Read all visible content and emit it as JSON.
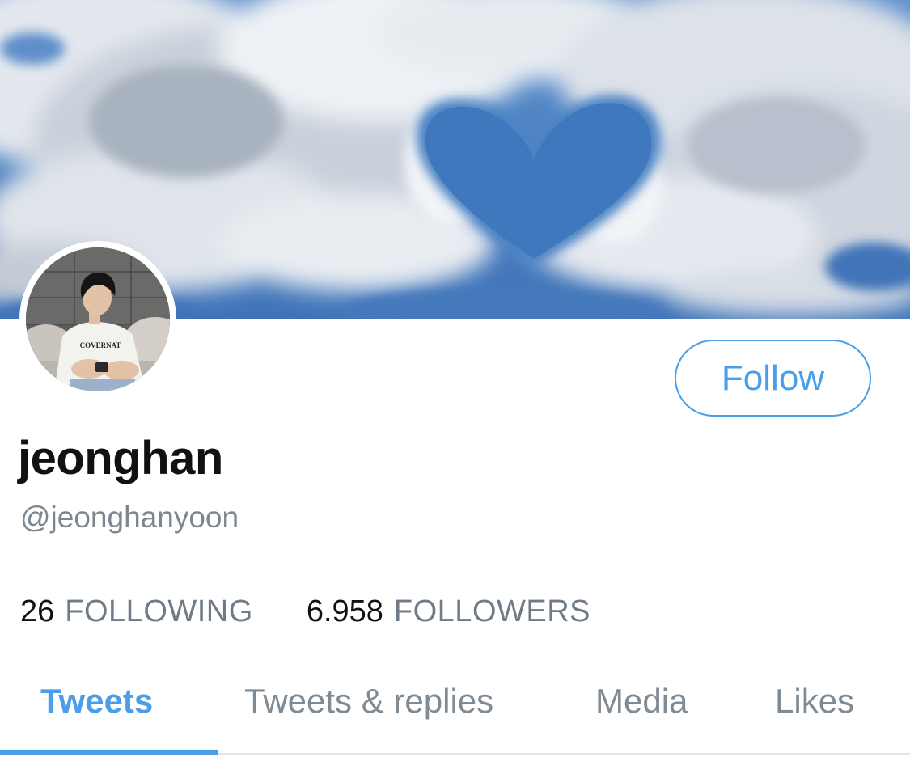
{
  "profile": {
    "display_name": "jeonghan",
    "handle": "@jeonghanyoon",
    "follow_label": "Follow"
  },
  "stats": {
    "following_count": "26",
    "following_label": "FOLLOWING",
    "followers_count": "6.958",
    "followers_label": "FOLLOWERS"
  },
  "tabs": [
    {
      "label": "Tweets",
      "active": true
    },
    {
      "label": "Tweets & replies",
      "active": false
    },
    {
      "label": "Media",
      "active": false
    },
    {
      "label": "Likes",
      "active": false
    }
  ],
  "avatar": {
    "shirt_text": "COVERNAT"
  },
  "colors": {
    "accent": "#4a9de8",
    "secondary_text": "#7b8691",
    "primary_text": "#111111",
    "sky": "#4a7fc0"
  }
}
